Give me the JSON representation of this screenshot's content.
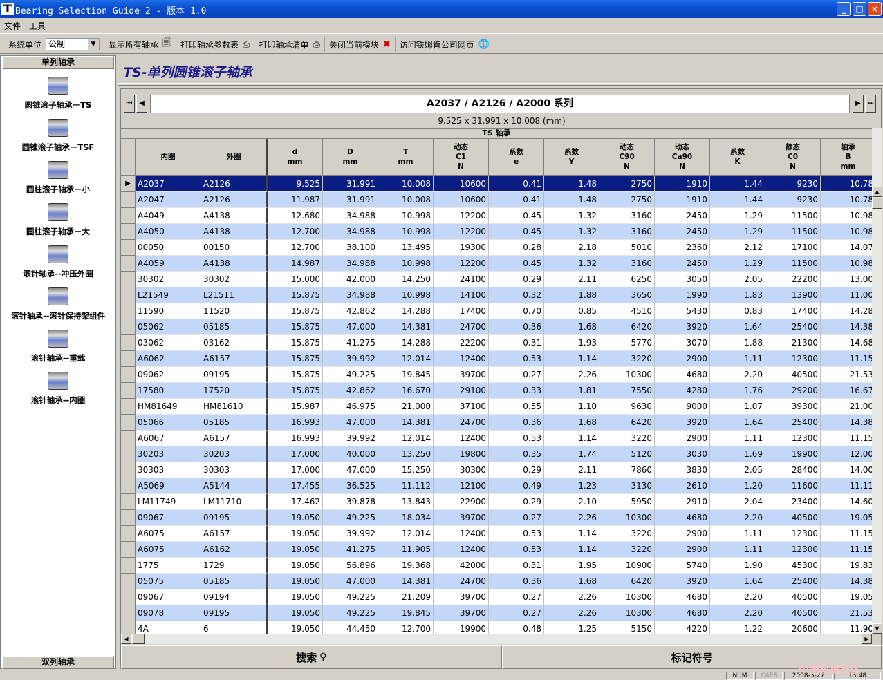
{
  "window": {
    "title": "Bearing Selection Guide 2 - 版本 1.0",
    "logo": "T",
    "min": "_",
    "max": "□",
    "close": "×"
  },
  "menu": [
    "文件",
    "工具"
  ],
  "toolbar": {
    "unit_label": "系统单位",
    "unit_value": "公制",
    "show_all": "显示所有轴承",
    "print_params": "打印轴承参数表",
    "print_list": "打印轴承清单",
    "close_module": "关闭当前模块",
    "visit_web": "访问铁姆肯公司网页"
  },
  "sidebar": {
    "top_header": "单列轴承",
    "bottom_header": "双列轴承",
    "items": [
      {
        "label": "圆锥滚子轴承－TS",
        "icon": "taper-roller-bearing-icon"
      },
      {
        "label": "圆锥滚子轴承－TSF",
        "icon": "taper-roller-bearing-flange-icon"
      },
      {
        "label": "圆柱滚子轴承－小",
        "icon": "cylindrical-roller-bearing-small-icon"
      },
      {
        "label": "圆柱滚子轴承－大",
        "icon": "cylindrical-roller-bearing-large-icon"
      },
      {
        "label": "滚针轴承--冲压外圈",
        "icon": "needle-bearing-drawn-cup-icon"
      },
      {
        "label": "滚针轴承--滚针保持架组件",
        "icon": "needle-cage-assembly-icon"
      },
      {
        "label": "滚针轴承--重载",
        "icon": "needle-bearing-heavy-icon"
      },
      {
        "label": "滚针轴承--内圈",
        "icon": "needle-bearing-inner-ring-icon"
      }
    ]
  },
  "main": {
    "page_title": "TS-单列圆锥滚子轴承",
    "series": "A2037 / A2126  /  A2000 系列",
    "size": "9.525 x 31.991 x 10.008 (mm)",
    "group_header": "TS 轴承",
    "search_label": "搜索",
    "symbols_label": "标记符号"
  },
  "columns": [
    [
      "内圈"
    ],
    [
      "外圈"
    ],
    [
      "d",
      "mm"
    ],
    [
      "D",
      "mm"
    ],
    [
      "T",
      "mm"
    ],
    [
      "动态",
      "C1",
      "N"
    ],
    [
      "系数",
      "e"
    ],
    [
      "系数",
      "Y"
    ],
    [
      "动态",
      "C90",
      "N"
    ],
    [
      "动态",
      "Ca90",
      "N"
    ],
    [
      "系数",
      "K"
    ],
    [
      "静态",
      "C0",
      "N"
    ],
    [
      "轴承",
      "B",
      "mm"
    ]
  ],
  "rows": [
    [
      "A2037",
      "A2126",
      "9.525",
      "31.991",
      "10.008",
      "10600",
      "0.41",
      "1.48",
      "2750",
      "1910",
      "1.44",
      "9230",
      "10.78"
    ],
    [
      "A2047",
      "A2126",
      "11.987",
      "31.991",
      "10.008",
      "10600",
      "0.41",
      "1.48",
      "2750",
      "1910",
      "1.44",
      "9230",
      "10.78"
    ],
    [
      "A4049",
      "A4138",
      "12.680",
      "34.988",
      "10.998",
      "12200",
      "0.45",
      "1.32",
      "3160",
      "2450",
      "1.29",
      "11500",
      "10.98"
    ],
    [
      "A4050",
      "A4138",
      "12.700",
      "34.988",
      "10.998",
      "12200",
      "0.45",
      "1.32",
      "3160",
      "2450",
      "1.29",
      "11500",
      "10.98"
    ],
    [
      "00050",
      "00150",
      "12.700",
      "38.100",
      "13.495",
      "19300",
      "0.28",
      "2.18",
      "5010",
      "2360",
      "2.12",
      "17100",
      "14.07"
    ],
    [
      "A4059",
      "A4138",
      "14.987",
      "34.988",
      "10.998",
      "12200",
      "0.45",
      "1.32",
      "3160",
      "2450",
      "1.29",
      "11500",
      "10.98"
    ],
    [
      "30302",
      "30302",
      "15.000",
      "42.000",
      "14.250",
      "24100",
      "0.29",
      "2.11",
      "6250",
      "3050",
      "2.05",
      "22200",
      "13.00"
    ],
    [
      "L21549",
      "L21511",
      "15.875",
      "34.988",
      "10.998",
      "14100",
      "0.32",
      "1.88",
      "3650",
      "1990",
      "1.83",
      "13900",
      "11.00"
    ],
    [
      "11590",
      "11520",
      "15.875",
      "42.862",
      "14.288",
      "17400",
      "0.70",
      "0.85",
      "4510",
      "5430",
      "0.83",
      "17400",
      "14.28"
    ],
    [
      "05062",
      "05185",
      "15.875",
      "47.000",
      "14.381",
      "24700",
      "0.36",
      "1.68",
      "6420",
      "3920",
      "1.64",
      "25400",
      "14.38"
    ],
    [
      "03062",
      "03162",
      "15.875",
      "41.275",
      "14.288",
      "22200",
      "0.31",
      "1.93",
      "5770",
      "3070",
      "1.88",
      "21300",
      "14.68"
    ],
    [
      "A6062",
      "A6157",
      "15.875",
      "39.992",
      "12.014",
      "12400",
      "0.53",
      "1.14",
      "3220",
      "2900",
      "1.11",
      "12300",
      "11.15"
    ],
    [
      "09062",
      "09195",
      "15.875",
      "49.225",
      "19.845",
      "39700",
      "0.27",
      "2.26",
      "10300",
      "4680",
      "2.20",
      "40500",
      "21.53"
    ],
    [
      "17580",
      "17520",
      "15.875",
      "42.862",
      "16.670",
      "29100",
      "0.33",
      "1.81",
      "7550",
      "4280",
      "1.76",
      "29200",
      "16.67"
    ],
    [
      "HM81649",
      "HM81610",
      "15.987",
      "46.975",
      "21.000",
      "37100",
      "0.55",
      "1.10",
      "9630",
      "9000",
      "1.07",
      "39300",
      "21.00"
    ],
    [
      "05066",
      "05185",
      "16.993",
      "47.000",
      "14.381",
      "24700",
      "0.36",
      "1.68",
      "6420",
      "3920",
      "1.64",
      "25400",
      "14.38"
    ],
    [
      "A6067",
      "A6157",
      "16.993",
      "39.992",
      "12.014",
      "12400",
      "0.53",
      "1.14",
      "3220",
      "2900",
      "1.11",
      "12300",
      "11.15"
    ],
    [
      "30203",
      "30203",
      "17.000",
      "40.000",
      "13.250",
      "19800",
      "0.35",
      "1.74",
      "5120",
      "3030",
      "1.69",
      "19900",
      "12.00"
    ],
    [
      "30303",
      "30303",
      "17.000",
      "47.000",
      "15.250",
      "30300",
      "0.29",
      "2.11",
      "7860",
      "3830",
      "2.05",
      "28400",
      "14.00"
    ],
    [
      "A5069",
      "A5144",
      "17.455",
      "36.525",
      "11.112",
      "12100",
      "0.49",
      "1.23",
      "3130",
      "2610",
      "1.20",
      "11600",
      "11.11"
    ],
    [
      "LM11749",
      "LM11710",
      "17.462",
      "39.878",
      "13.843",
      "22900",
      "0.29",
      "2.10",
      "5950",
      "2910",
      "2.04",
      "23400",
      "14.60"
    ],
    [
      "09067",
      "09195",
      "19.050",
      "49.225",
      "18.034",
      "39700",
      "0.27",
      "2.26",
      "10300",
      "4680",
      "2.20",
      "40500",
      "19.05"
    ],
    [
      "A6075",
      "A6157",
      "19.050",
      "39.992",
      "12.014",
      "12400",
      "0.53",
      "1.14",
      "3220",
      "2900",
      "1.11",
      "12300",
      "11.15"
    ],
    [
      "A6075",
      "A6162",
      "19.050",
      "41.275",
      "11.905",
      "12400",
      "0.53",
      "1.14",
      "3220",
      "2900",
      "1.11",
      "12300",
      "11.15"
    ],
    [
      "1775",
      "1729",
      "19.050",
      "56.896",
      "19.368",
      "42000",
      "0.31",
      "1.95",
      "10900",
      "5740",
      "1.90",
      "45300",
      "19.83"
    ],
    [
      "05075",
      "05185",
      "19.050",
      "47.000",
      "14.381",
      "24700",
      "0.36",
      "1.68",
      "6420",
      "3920",
      "1.64",
      "25400",
      "14.38"
    ],
    [
      "09067",
      "09194",
      "19.050",
      "49.225",
      "21.209",
      "39700",
      "0.27",
      "2.26",
      "10300",
      "4680",
      "2.20",
      "40500",
      "19.05"
    ],
    [
      "09078",
      "09195",
      "19.050",
      "49.225",
      "19.845",
      "39700",
      "0.27",
      "2.26",
      "10300",
      "4680",
      "2.20",
      "40500",
      "21.53"
    ],
    [
      "4A",
      "6",
      "19.050",
      "44.450",
      "12.700",
      "19900",
      "0.48",
      "1.25",
      "5150",
      "4220",
      "1.22",
      "20600",
      "11.90"
    ]
  ],
  "status": {
    "num": "NUM",
    "caps": "CAPS",
    "date": "2008-3-27",
    "time": "13:48"
  },
  "watermark": "中国机械社区",
  "colors": {
    "selected_row": "#0a1d82",
    "alt_row": "#c3d8f8",
    "title_blue": "#1a1a8c",
    "titlebar": "#0a4fd0"
  }
}
